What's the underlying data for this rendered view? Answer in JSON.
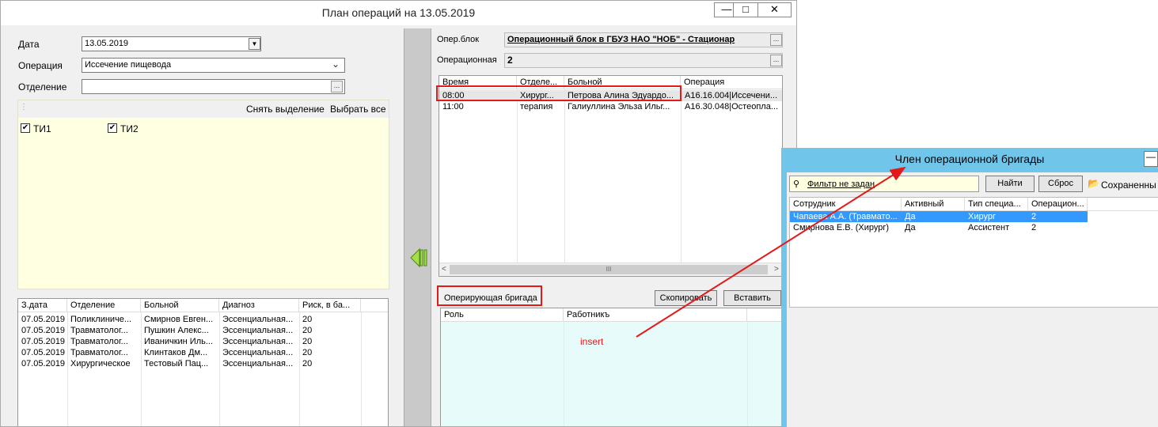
{
  "main_window": {
    "title": "План операций на 13.05.2019",
    "controls": {
      "minimize": "—",
      "maximize": "□",
      "close": "✕"
    },
    "form": {
      "date_label": "Дата",
      "date_value": "13.05.2019",
      "operation_label": "Операция",
      "operation_value": "Иссечение пищевода",
      "department_label": "Отделение",
      "department_value": "",
      "ellipsis": "..."
    },
    "checklist": {
      "clear_label": "Снять выделение",
      "select_all_label": "Выбрать все",
      "items": [
        {
          "label": "ТИ1",
          "checked": true
        },
        {
          "label": "ТИ2",
          "checked": true
        }
      ]
    },
    "request_table": {
      "columns": [
        "З.дата",
        "Отделение",
        "Больной",
        "Диагноз",
        "Риск, в ба..."
      ],
      "rows": [
        [
          "07.05.2019",
          "Поликлиниче...",
          "Смирнов Евген...",
          "Эссенциальная...",
          "20"
        ],
        [
          "07.05.2019",
          "Травматолог...",
          "Пушкин Алекс...",
          "Эссенциальная...",
          "20"
        ],
        [
          "07.05.2019",
          "Травматолог...",
          "Иваничкин Иль...",
          "Эссенциальная...",
          "20"
        ],
        [
          "07.05.2019",
          "Травматолог...",
          "Клинтаков Дм...",
          "Эссенциальная...",
          "20"
        ],
        [
          "07.05.2019",
          "Хирургическое",
          "Тестовый Пац...",
          "Эссенциальная...",
          "20"
        ]
      ]
    },
    "op_block_label": "Опер.блок",
    "op_block_value": "Операционный блок в ГБУЗ НАО \"НОБ\" - Стационар",
    "op_room_label": "Операционная",
    "op_room_value": "2",
    "schedule_table": {
      "columns": [
        "Время",
        "Отделе...",
        "Больной",
        "Операция"
      ],
      "rows": [
        [
          "08:00",
          "Хирург...",
          "Петрова Алина Эдуардо...",
          "A16.16.004|Иссечени..."
        ],
        [
          "11:00",
          "терапия",
          "Галиуллина Эльза Ильг...",
          "A16.30.048|Остеопла..."
        ]
      ],
      "scroll_left": "<",
      "scroll_thumb": "III",
      "scroll_right": ">"
    },
    "team": {
      "label": "Оперирующая бригада",
      "copy_label": "Скопировать",
      "paste_label": "Вставить",
      "columns": [
        "Роль",
        "Работникъ"
      ]
    },
    "annotation": "insert"
  },
  "team_window": {
    "title": "Член операционной бригады",
    "filter_label": "Фильтр не задан",
    "find_label": "Найти",
    "reset_label": "Сброс",
    "saved_label": "Сохраненны",
    "columns": [
      "Сотрудник",
      "Активный",
      "Тип специа...",
      "Операцион..."
    ],
    "rows": [
      [
        "Чапаева А.А. (Травмато...",
        "Да",
        "Хирург",
        "2"
      ],
      [
        "Смирнова Е.В. (Хирург)",
        "Да",
        "Ассистент",
        "2"
      ]
    ]
  },
  "colors": {
    "annotation_red": "#e21a1a",
    "selection_blue": "#3399ff",
    "window_frame": "#70c6ea",
    "check_panel": "#ffffe1",
    "team_grid": "#e8fbfb"
  }
}
